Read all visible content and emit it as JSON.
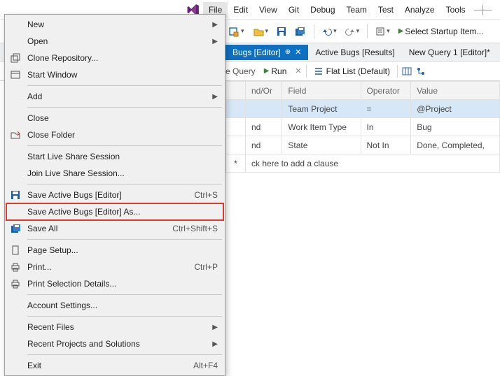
{
  "menubar": {
    "items": [
      "File",
      "Edit",
      "View",
      "Git",
      "Debug",
      "Team",
      "Test",
      "Analyze",
      "Tools"
    ],
    "active": 0
  },
  "toolbar": {
    "startup_label": "Select Startup Item..."
  },
  "tabs": {
    "items": [
      {
        "label": "Bugs [Editor]",
        "active": true,
        "pinned": true,
        "closable": true
      },
      {
        "label": "Active Bugs [Results]",
        "active": false
      },
      {
        "label": "New Query 1 [Editor]*",
        "active": false
      }
    ]
  },
  "querybar": {
    "query_label": "e Query",
    "run_label": "Run",
    "flatlist_label": "Flat List (Default)"
  },
  "grid": {
    "headers": [
      "nd/Or",
      "Field",
      "Operator",
      "Value"
    ],
    "rows": [
      {
        "andor": "",
        "field": "Team Project",
        "op": "=",
        "val": "@Project",
        "selected": true
      },
      {
        "andor": "nd",
        "field": "Work Item Type",
        "op": "In",
        "val": "Bug"
      },
      {
        "andor": "nd",
        "field": "State",
        "op": "Not In",
        "val": "Done, Completed,"
      }
    ],
    "hint": "ck here to add a clause"
  },
  "file_menu": {
    "groups": [
      [
        {
          "id": "new",
          "label": "New",
          "submenu": true
        },
        {
          "id": "open",
          "label": "Open",
          "submenu": true
        },
        {
          "id": "clone",
          "label": "Clone Repository...",
          "icon": "clone-icon"
        },
        {
          "id": "startwin",
          "label": "Start Window",
          "icon": "window-icon"
        }
      ],
      [
        {
          "id": "add",
          "label": "Add",
          "submenu": true
        }
      ],
      [
        {
          "id": "close",
          "label": "Close"
        },
        {
          "id": "closefolder",
          "label": "Close Folder",
          "icon": "folder-icon"
        }
      ],
      [
        {
          "id": "startls",
          "label": "Start Live Share Session"
        },
        {
          "id": "joinls",
          "label": "Join Live Share Session..."
        }
      ],
      [
        {
          "id": "save",
          "label": "Save Active Bugs [Editor]",
          "shortcut": "Ctrl+S",
          "icon": "save-icon"
        },
        {
          "id": "saveas",
          "label": "Save Active Bugs [Editor] As...",
          "highlight": true
        },
        {
          "id": "saveall",
          "label": "Save All",
          "shortcut": "Ctrl+Shift+S",
          "icon": "saveall-icon"
        }
      ],
      [
        {
          "id": "pagesetup",
          "label": "Page Setup...",
          "icon": "page-icon"
        },
        {
          "id": "print",
          "label": "Print...",
          "shortcut": "Ctrl+P",
          "icon": "print-icon"
        },
        {
          "id": "printsel",
          "label": "Print Selection Details...",
          "icon": "print-icon"
        }
      ],
      [
        {
          "id": "account",
          "label": "Account Settings..."
        }
      ],
      [
        {
          "id": "recentf",
          "label": "Recent Files",
          "submenu": true
        },
        {
          "id": "recentp",
          "label": "Recent Projects and Solutions",
          "submenu": true
        }
      ],
      [
        {
          "id": "exit",
          "label": "Exit",
          "shortcut": "Alt+F4"
        }
      ]
    ]
  }
}
